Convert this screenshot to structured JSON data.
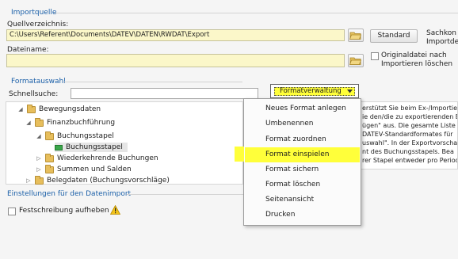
{
  "import_group": {
    "title": "Importquelle",
    "source_dir_label": "Quellverzeichnis:",
    "source_dir_value": "C:\\Users\\Referent\\Documents\\DATEV\\DATEN\\RWDAT\\Export",
    "standard_button": "Standard",
    "side_text_1": "Sachkon",
    "side_text_2": "Importde",
    "filename_label": "Dateiname:",
    "filename_value": "",
    "move_file_line1": "Originaldatei nach",
    "move_file_line2": "Importieren löschen"
  },
  "format_group": {
    "title": "Formatauswahl",
    "quicksearch_label": "Schnellsuche:",
    "quicksearch_value": "",
    "format_dropdown_label": "Formatverwaltung",
    "tree": [
      {
        "label": "Bewegungsdaten",
        "expanded": true
      },
      {
        "label": "Finanzbuchführung",
        "expanded": true
      },
      {
        "label": "Buchungsstapel",
        "expanded": true
      },
      {
        "label": "Buchungsstapel",
        "selected": true
      },
      {
        "label": "Wiederkehrende Buchungen",
        "expanded": false
      },
      {
        "label": "Summen und Salden",
        "expanded": false
      },
      {
        "label": "Belegdaten (Buchungsvorschläge)",
        "expanded": false
      }
    ],
    "description_lines": [
      "erstützt Sie beim Ex-/Importieren",
      "ie den/die zu exportierenden B",
      "ügen\" aus. Die gesamte Liste d",
      "DATEV-Standardformates für",
      "uswahl\". In der Exportvorschau",
      "nt des Buchungsstapels. Bea",
      "rer Stapel entweder pro Period"
    ]
  },
  "settings_group": {
    "title": "Einstellungen für den Datenimport",
    "lock_checkbox_label": "Festschreibung aufheben"
  },
  "context_menu": {
    "items": [
      "Neues Format anlegen",
      "Umbenennen",
      "Format zuordnen",
      "Format einspielen",
      "Format sichern",
      "Format löschen",
      "Seitenansicht",
      "Drucken"
    ],
    "highlighted_index": 3
  },
  "colors": {
    "group_title": "#1a5fa8",
    "highlight": "#ffff3a",
    "field_yellow": "#fbf7c9"
  }
}
